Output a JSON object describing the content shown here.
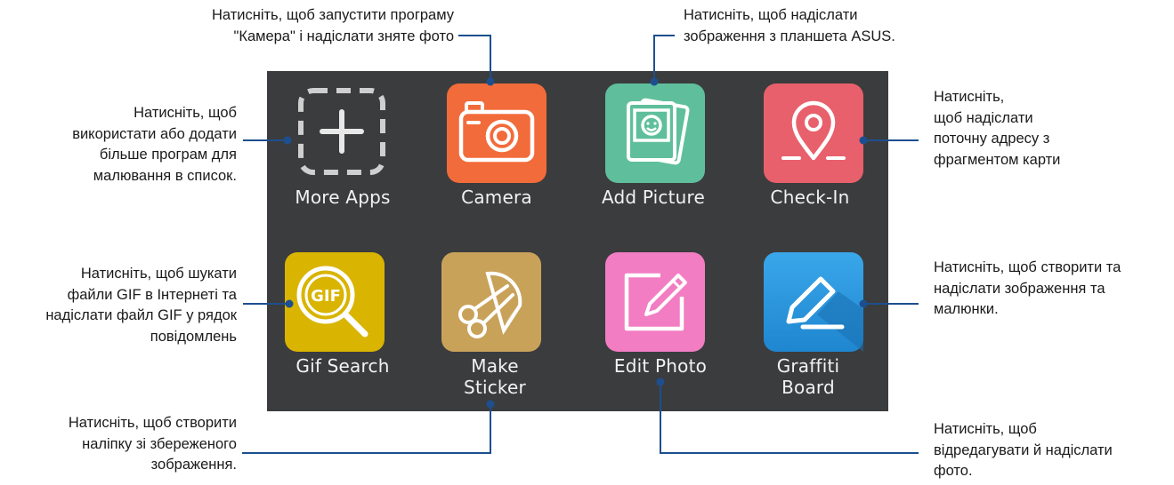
{
  "apps": [
    {
      "label": [
        "More Apps"
      ],
      "icon": "add-apps-icon"
    },
    {
      "label": [
        "Camera"
      ],
      "icon": "camera-icon"
    },
    {
      "label": [
        "Add Picture"
      ],
      "icon": "photo-stack-icon"
    },
    {
      "label": [
        "Check-In"
      ],
      "icon": "map-pin-icon"
    },
    {
      "label": [
        "Gif Search"
      ],
      "icon": "gif-search-icon"
    },
    {
      "label": [
        "Make",
        "Sticker"
      ],
      "icon": "scissors-icon"
    },
    {
      "label": [
        "Edit Photo"
      ],
      "icon": "pencil-frame-icon"
    },
    {
      "label": [
        "Graffiti",
        "Board"
      ],
      "icon": "pen-icon"
    }
  ],
  "callouts": {
    "camera": [
      "Натисніть, щоб запустити програму",
      "\"Камера\" і надіслати зняте фото"
    ],
    "add_picture": [
      "Натисніть, щоб надіслати",
      "зображення з планшета ASUS."
    ],
    "more_apps": [
      "Натисніть, щоб",
      "використати або додати",
      "більше програм для",
      "малювання в список."
    ],
    "check_in": [
      "Натисніть,",
      "щоб надіслати",
      "поточну адресу з",
      "фрагментом карти"
    ],
    "gif_search": [
      "Натисніть, щоб шукати",
      "файли GIF в Інтернеті та",
      "надіслати файл GIF у рядок",
      "повідомлень"
    ],
    "graffiti": [
      "Натисніть, щоб створити та",
      "надіслати зображення та",
      "малюнки."
    ],
    "make_sticker": [
      "Натисніть, щоб створити",
      "наліпку зі збереженого",
      "зображення."
    ],
    "edit_photo": [
      "Натисніть, щоб",
      "відредагувати й надіслати",
      "фото."
    ]
  },
  "colors": {
    "panel": "#3b3c3e",
    "camera": "#f26b3a",
    "add_picture": "#5fbf9c",
    "check_in": "#e8606c",
    "gif_search": "#d9b400",
    "make_sticker": "#c9a25a",
    "edit_photo": "#f27dc3",
    "graffiti": "#2b9be0",
    "leader": "#1d4f8f"
  }
}
